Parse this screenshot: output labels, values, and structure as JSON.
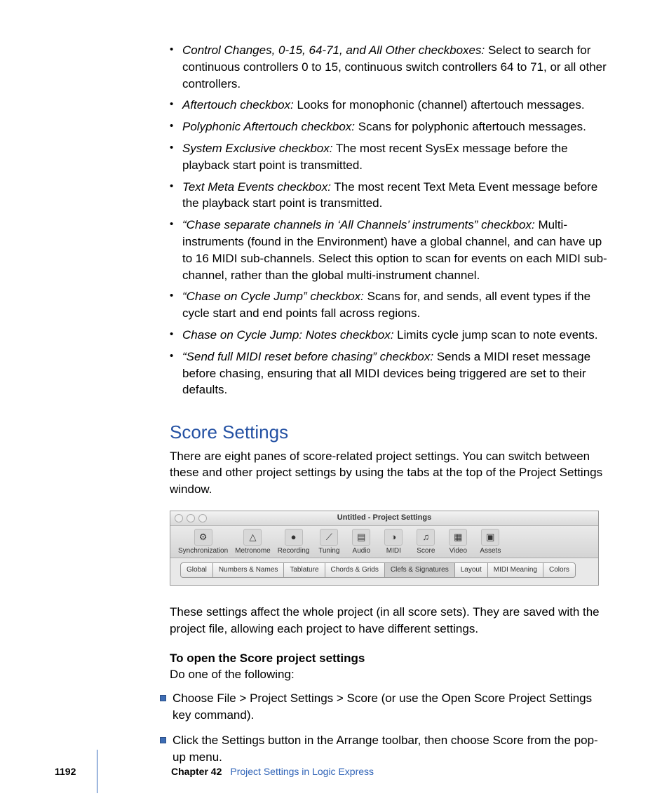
{
  "bullets": [
    {
      "term": "Control Changes, 0-15, 64-71, and All Other checkboxes:",
      "text": " Select to search for continuous controllers 0 to 15, continuous switch controllers 64 to 71, or all other controllers."
    },
    {
      "term": "Aftertouch checkbox:",
      "text": " Looks for monophonic (channel) aftertouch messages."
    },
    {
      "term": "Polyphonic Aftertouch checkbox:",
      "text": " Scans for polyphonic aftertouch messages."
    },
    {
      "term": "System Exclusive checkbox:",
      "text": " The most recent SysEx message before the playback start point is transmitted."
    },
    {
      "term": "Text Meta Events checkbox:",
      "text": " The most recent Text Meta Event message before the playback start point is transmitted."
    },
    {
      "term": "“Chase separate channels in ‘All Channels’ instruments” checkbox:",
      "text": " Multi-instruments (found in the Environment) have a global channel, and can have up to 16 MIDI sub-channels. Select this option to scan for events on each MIDI sub-channel, rather than the global multi-instrument channel."
    },
    {
      "term": "“Chase on Cycle Jump” checkbox:",
      "text": " Scans for, and sends, all event types if the cycle start and end points fall across regions."
    },
    {
      "term": "Chase on Cycle Jump:  Notes checkbox:",
      "text": " Limits cycle jump scan to note events."
    },
    {
      "term": "“Send full MIDI reset before chasing” checkbox:",
      "text": " Sends a MIDI reset message before chasing, ensuring that all MIDI devices being triggered are set to their defaults."
    }
  ],
  "section_heading": "Score Settings",
  "section_intro": "There are eight panes of score-related project settings. You can switch between these and other project settings by using the tabs at the top of the Project Settings window.",
  "window": {
    "title": "Untitled - Project Settings",
    "toolbar": [
      {
        "icon": "⚙",
        "label": "Synchronization"
      },
      {
        "icon": "△",
        "label": "Metronome"
      },
      {
        "icon": "●",
        "label": "Recording"
      },
      {
        "icon": "⟋",
        "label": "Tuning"
      },
      {
        "icon": "▤",
        "label": "Audio"
      },
      {
        "icon": "◑",
        "label": "MIDI"
      },
      {
        "icon": "♫",
        "label": "Score"
      },
      {
        "icon": "▦",
        "label": "Video"
      },
      {
        "icon": "▣",
        "label": "Assets"
      }
    ],
    "tabs": [
      {
        "label": "Global",
        "active": false
      },
      {
        "label": "Numbers & Names",
        "active": false
      },
      {
        "label": "Tablature",
        "active": false
      },
      {
        "label": "Chords & Grids",
        "active": false
      },
      {
        "label": "Clefs & Signatures",
        "active": true
      },
      {
        "label": "Layout",
        "active": false
      },
      {
        "label": "MIDI Meaning",
        "active": false
      },
      {
        "label": "Colors",
        "active": false
      }
    ]
  },
  "after_window": "These settings affect the whole project (in all score sets). They are saved with the project file, allowing each project to have different settings.",
  "subhead": "To open the Score project settings",
  "do_one": "Do one of the following:",
  "steps": [
    "Choose File > Project Settings > Score (or use the Open Score Project Settings key command).",
    "Click the Settings button in the Arrange toolbar, then choose Score from the pop-up menu."
  ],
  "footer": {
    "page": "1192",
    "chapter_label": "Chapter 42",
    "chapter_title": "Project Settings in Logic Express"
  }
}
